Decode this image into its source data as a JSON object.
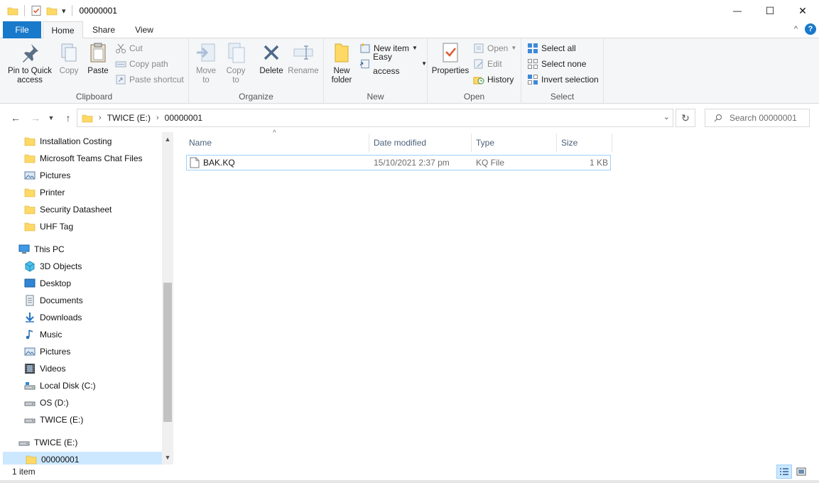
{
  "window": {
    "title": "00000001",
    "qat_dropdown": "▾",
    "minimize": "—",
    "maximize": "☐",
    "close": "✕"
  },
  "tabs": {
    "file": "File",
    "home": "Home",
    "share": "Share",
    "view": "View",
    "help": "?",
    "collapse": "^"
  },
  "ribbon": {
    "clipboard": {
      "label": "Clipboard",
      "pin_label": "Pin to Quick access",
      "copy_label": "Copy",
      "paste_label": "Paste",
      "cut_label": "Cut",
      "copy_path_label": "Copy path",
      "paste_shortcut_label": "Paste shortcut"
    },
    "organize": {
      "label": "Organize",
      "move_to_label": "Move to",
      "copy_to_label": "Copy to",
      "delete_label": "Delete",
      "rename_label": "Rename"
    },
    "new": {
      "label": "New",
      "new_folder_label": "New folder",
      "new_item_label": "New item",
      "easy_access_label": "Easy access"
    },
    "open": {
      "label": "Open",
      "properties_label": "Properties",
      "open_label": "Open",
      "edit_label": "Edit",
      "history_label": "History"
    },
    "select": {
      "label": "Select",
      "select_all_label": "Select all",
      "select_none_label": "Select none",
      "invert_selection_label": "Invert selection"
    }
  },
  "address": {
    "crumbs": [
      "TWICE (E:)",
      "00000001"
    ],
    "search_placeholder": "Search 00000001"
  },
  "nav_pane": {
    "items": [
      {
        "label": "Installation Costing",
        "icon": "folder-icon"
      },
      {
        "label": "Microsoft Teams Chat Files",
        "icon": "folder-icon"
      },
      {
        "label": "Pictures",
        "icon": "pictures-icon"
      },
      {
        "label": "Printer",
        "icon": "folder-icon"
      },
      {
        "label": "Security Datasheet",
        "icon": "folder-icon"
      },
      {
        "label": "UHF Tag",
        "icon": "folder-icon"
      },
      {
        "label": "This PC",
        "icon": "this-pc-icon"
      },
      {
        "label": "3D Objects",
        "icon": "3d-objects-icon"
      },
      {
        "label": "Desktop",
        "icon": "desktop-icon"
      },
      {
        "label": "Documents",
        "icon": "documents-icon"
      },
      {
        "label": "Downloads",
        "icon": "downloads-icon"
      },
      {
        "label": "Music",
        "icon": "music-icon"
      },
      {
        "label": "Pictures",
        "icon": "pictures-icon"
      },
      {
        "label": "Videos",
        "icon": "videos-icon"
      },
      {
        "label": "Local Disk (C:)",
        "icon": "local-disk-icon"
      },
      {
        "label": "OS (D:)",
        "icon": "drive-icon"
      },
      {
        "label": "TWICE (E:)",
        "icon": "drive-icon"
      },
      {
        "label": "TWICE (E:)",
        "icon": "drive-icon"
      },
      {
        "label": "00000001",
        "icon": "folder-icon"
      }
    ]
  },
  "file_list": {
    "columns": {
      "name": "Name",
      "date": "Date modified",
      "type": "Type",
      "size": "Size"
    },
    "rows": [
      {
        "name": "BAK.KQ",
        "date": "15/10/2021 2:37 pm",
        "type": "KQ File",
        "size": "1 KB"
      }
    ]
  },
  "status": {
    "count": "1 item"
  },
  "colors": {
    "accent": "#1979ca",
    "selection": "#cce8ff",
    "folder": "#ffd966"
  }
}
